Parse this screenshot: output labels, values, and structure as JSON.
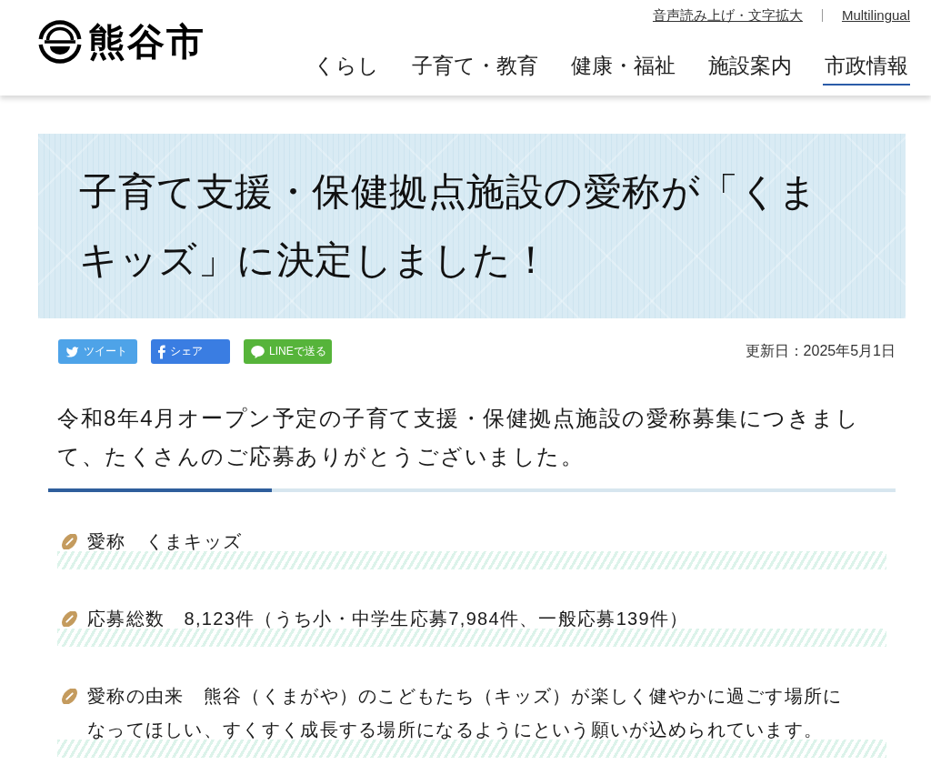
{
  "header": {
    "logo_text": "熊谷市",
    "utility_links": [
      "音声読み上げ・文字拡大",
      "Multilingual"
    ],
    "nav": [
      {
        "label": "くらし",
        "selected": false
      },
      {
        "label": "子育て・教育",
        "selected": false
      },
      {
        "label": "健康・福祉",
        "selected": false
      },
      {
        "label": "施設案内",
        "selected": false
      },
      {
        "label": "市政情報",
        "selected": true
      }
    ]
  },
  "page_title": "子育て支援・保健拠点施設の愛称が「くまキッズ」に決定しました！",
  "share_buttons": [
    {
      "kind": "twitter",
      "label": "ツイート",
      "color": "#4ea3e8"
    },
    {
      "kind": "facebook",
      "label": "シェア",
      "color": "#3a7de2"
    },
    {
      "kind": "line",
      "label": "LINEで送る",
      "color": "#56b43a"
    }
  ],
  "updated": "更新日：2025年5月1日",
  "intro": "令和8年4月オープン予定の子育て支援・保健拠点施設の愛称募集につきまして、たくさんのご応募ありがとうございました。",
  "items": [
    {
      "text": "愛称　くまキッズ"
    },
    {
      "text": "応募総数　8,123件（うち小・中学生応募7,984件、一般応募139件）"
    },
    {
      "text": "愛称の由来　熊谷（くまがや）のこどもたち（キッズ）が楽しく健やかに過ごす場所になってほしい、すくすく成長する場所になるようにという願いが込められています。"
    }
  ]
}
